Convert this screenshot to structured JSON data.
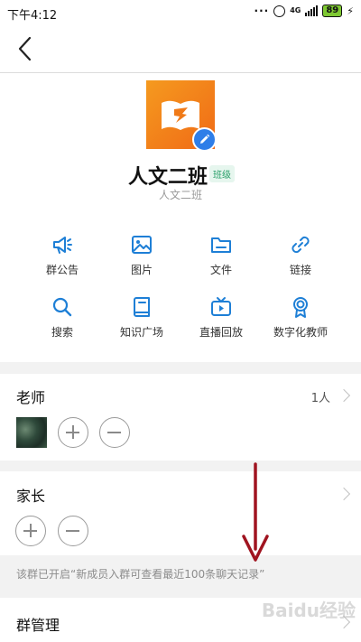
{
  "status_bar": {
    "time": "下午4:12",
    "network": "4G",
    "battery": "89"
  },
  "group": {
    "name": "人文二班",
    "tag": "班级",
    "subtitle": "人文二班"
  },
  "features": [
    {
      "label": "群公告",
      "icon": "megaphone-icon"
    },
    {
      "label": "图片",
      "icon": "image-icon"
    },
    {
      "label": "文件",
      "icon": "folder-icon"
    },
    {
      "label": "链接",
      "icon": "link-icon"
    },
    {
      "label": "搜索",
      "icon": "search-icon"
    },
    {
      "label": "知识广场",
      "icon": "book-icon"
    },
    {
      "label": "直播回放",
      "icon": "tv-play-icon"
    },
    {
      "label": "数字化教师",
      "icon": "award-icon"
    }
  ],
  "teachers": {
    "title": "老师",
    "count": "1人"
  },
  "parents": {
    "title": "家长"
  },
  "notice": "该群已开启“新成员入群可查看最近100条聊天记录”",
  "management": {
    "title": "群管理"
  },
  "watermark": "Baidu经验",
  "colors": {
    "accent": "#2f7ee8",
    "icon_blue": "#1e7fd6",
    "annotation_red": "#a01420",
    "tag_green": "#2aa06a"
  }
}
